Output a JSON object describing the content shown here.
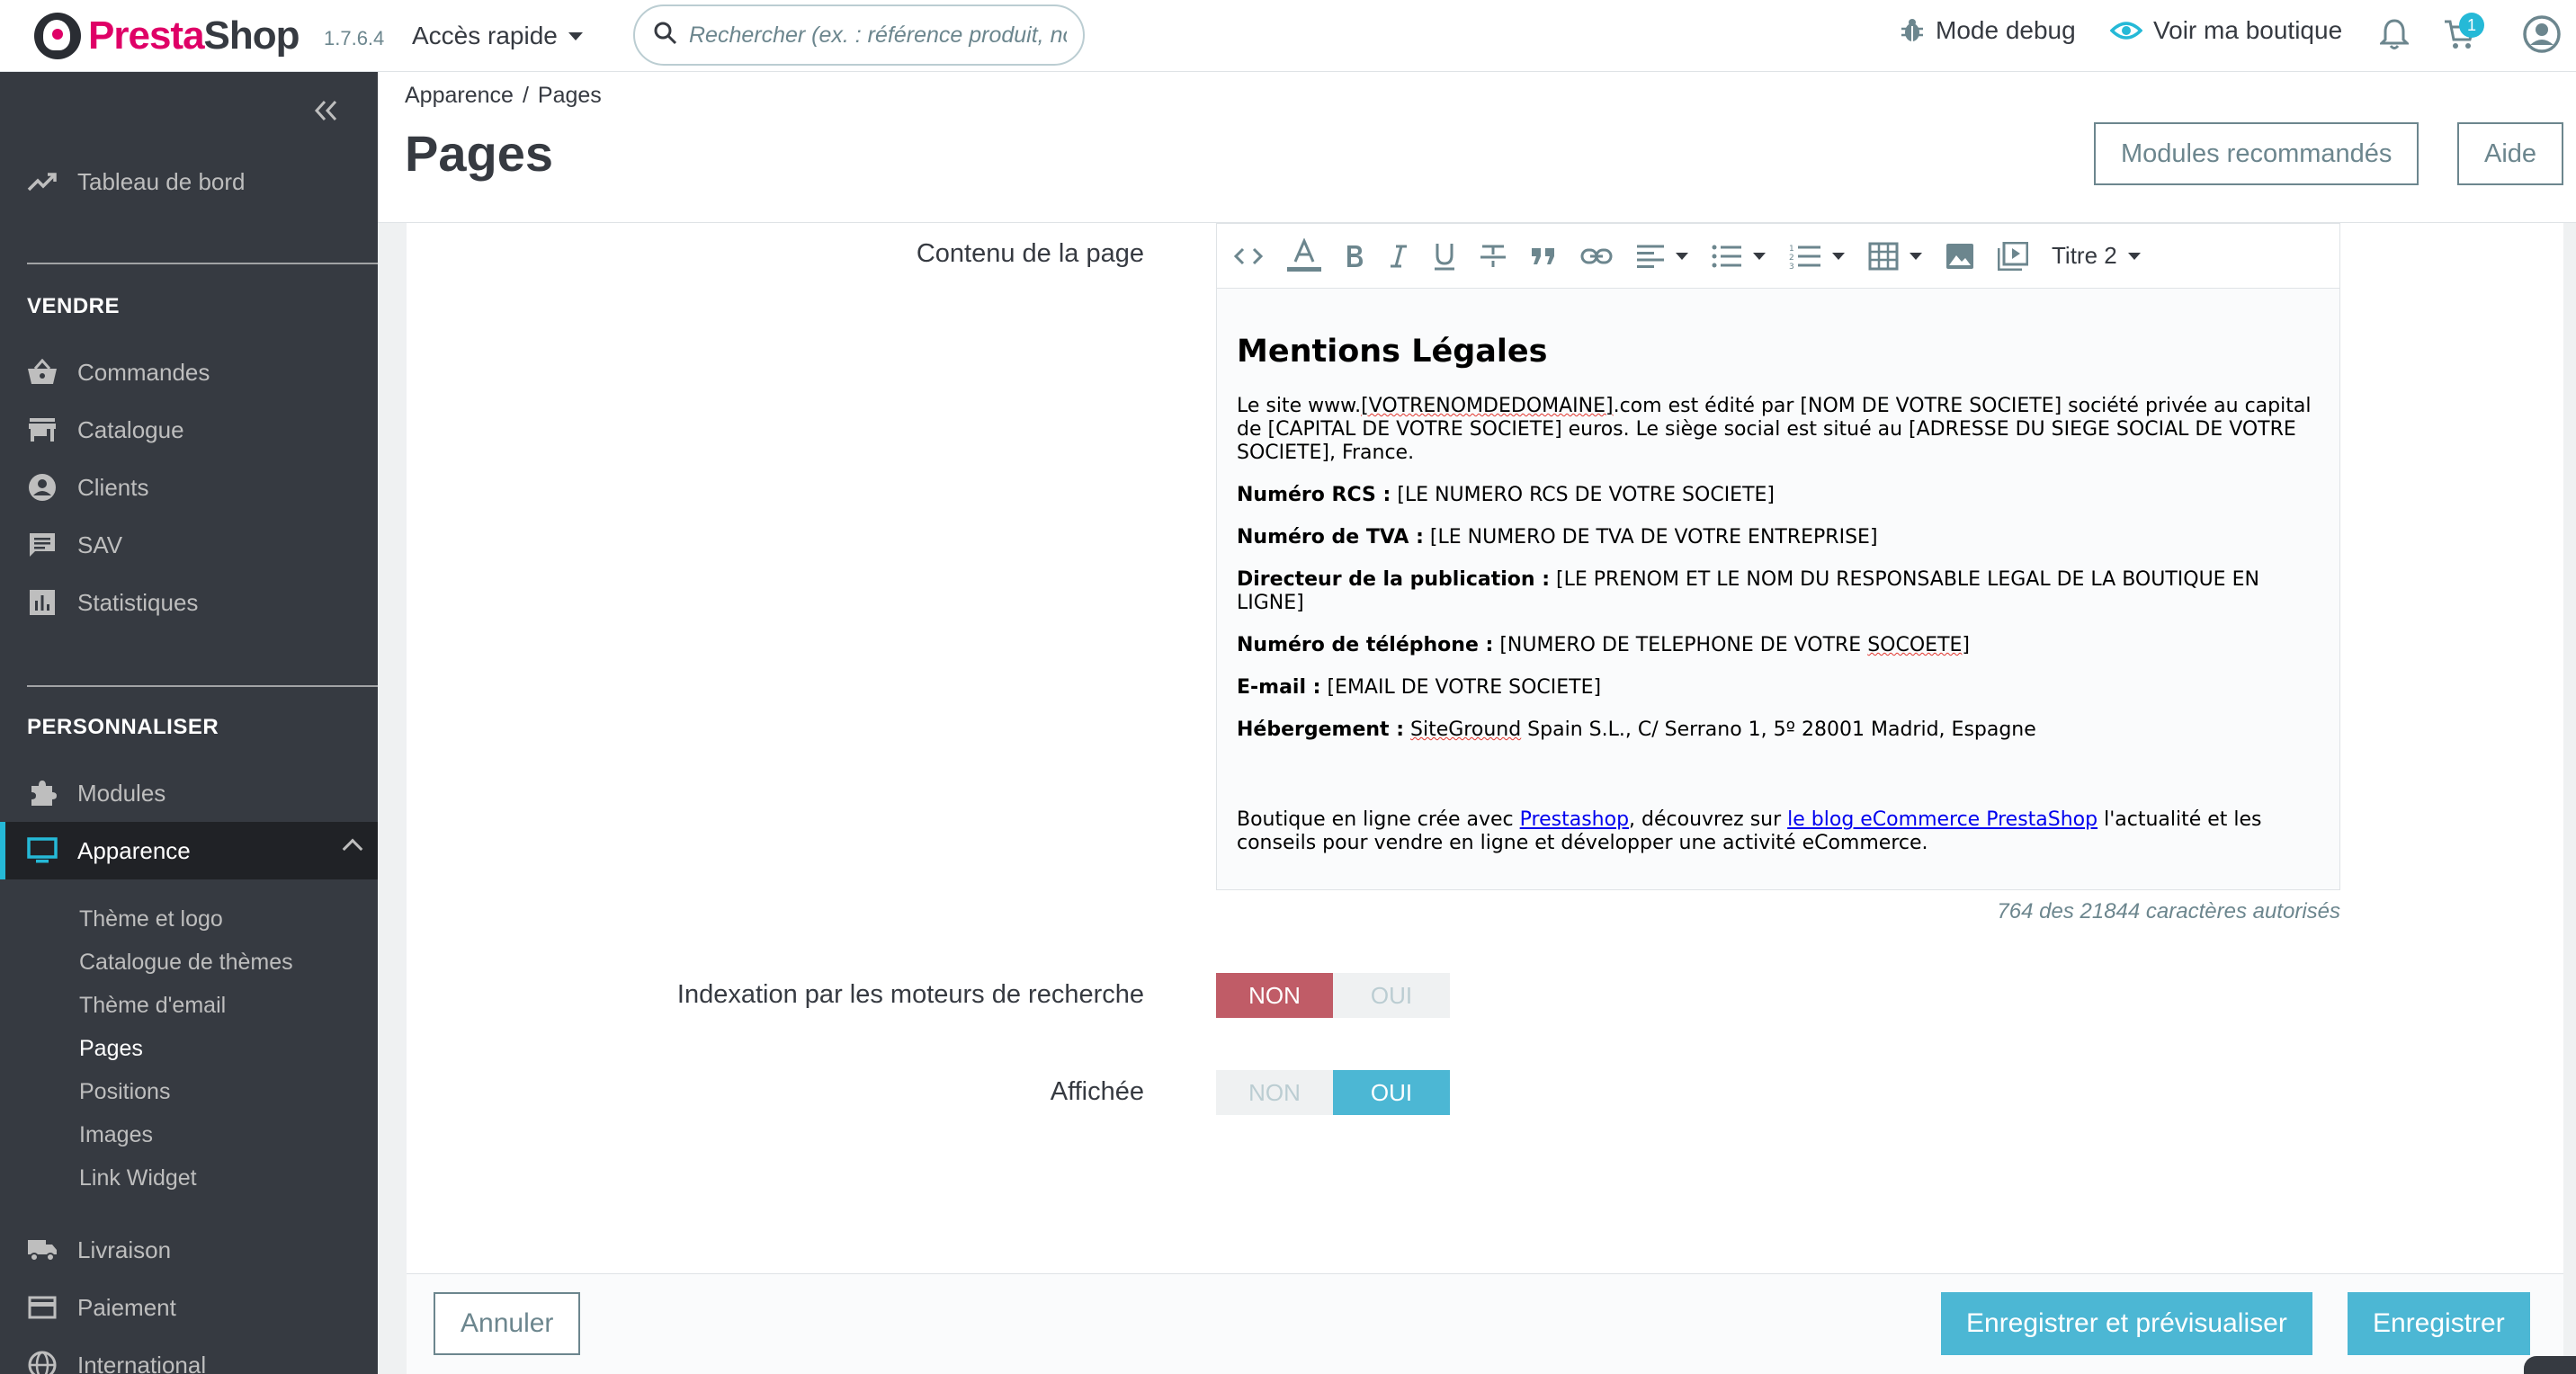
{
  "header": {
    "brand": "PrestaShop",
    "version": "1.7.6.4",
    "quick_access": "Accès rapide",
    "search_placeholder": "Rechercher (ex. : référence produit, nom",
    "debug_label": "Mode debug",
    "view_shop_label": "Voir ma boutique",
    "orders_badge": "1"
  },
  "sidebar": {
    "dashboard": "Tableau de bord",
    "section_sell": "VENDRE",
    "sell_items": [
      "Commandes",
      "Catalogue",
      "Clients",
      "SAV",
      "Statistiques"
    ],
    "section_customize": "PERSONNALISER",
    "modules": "Modules",
    "appearance": "Apparence",
    "appearance_sub": [
      "Thème et logo",
      "Catalogue de thèmes",
      "Thème d'email",
      "Pages",
      "Positions",
      "Images",
      "Link Widget"
    ],
    "shipping": "Livraison",
    "payment": "Paiement",
    "international": "International"
  },
  "pagehead": {
    "breadcrumb_parent": "Apparence",
    "breadcrumb_sep": "/",
    "breadcrumb_current": "Pages",
    "title": "Pages",
    "recommended_modules": "Modules recommandés",
    "help": "Aide"
  },
  "form": {
    "content_label": "Contenu de la page",
    "toolbar_heading": "Titre 2",
    "doc": {
      "heading": "Mentions Légales",
      "intro_a": "Le site www.",
      "intro_spell": "[VOTRENOMDEDOMAINE]",
      "intro_b": ".com est édité par [NOM DE VOTRE SOCIETE] société privée au capital de [CAPITAL DE VOTRE SOCIETE] euros. Le siège social est situé au [ADRESSE DU SIEGE SOCIAL DE VOTRE SOCIETE], France.",
      "rcs_label": "Numéro RCS :",
      "rcs_value": " [LE NUMERO RCS DE VOTRE SOCIETE]",
      "tva_label": "Numéro de TVA :",
      "tva_value": " [LE NUMERO DE TVA DE VOTRE ENTREPRISE]",
      "director_label": "Directeur de la publication :",
      "director_value": " [LE PRENOM ET LE NOM DU RESPONSABLE LEGAL DE LA BOUTIQUE EN LIGNE]",
      "phone_label": "Numéro de téléphone :",
      "phone_value_a": " [NUMERO DE TELEPHONE DE VOTRE ",
      "phone_value_spell": "SOCOETE",
      "phone_value_b": "]",
      "email_label": "E-mail :",
      "email_value": " [EMAIL DE VOTRE SOCIETE]",
      "host_label": "Hébergement :",
      "host_spell": "SiteGround",
      "host_value": " Spain S.L., C/ Serrano 1, 5º 28001 Madrid, Espagne",
      "footer_a": "Boutique en ligne crée avec ",
      "footer_link1": "Prestashop",
      "footer_b": ", découvrez sur ",
      "footer_link2": "le blog eCommerce PrestaShop",
      "footer_c": " l'actualité et les conseils pour vendre en ligne et développer une activité eCommerce."
    },
    "char_count": "764 des 21844 caractères autorisés",
    "indexation_label": "Indexation par les moteurs de recherche",
    "indexation_value": "NON",
    "displayed_label": "Affichée",
    "displayed_value": "OUI",
    "no": "NON",
    "yes": "OUI"
  },
  "footer": {
    "cancel": "Annuler",
    "save_preview": "Enregistrer et prévisualiser",
    "save": "Enregistrer"
  },
  "colors": {
    "brand": "#df0067",
    "primary": "#4cb7d4",
    "danger_switch": "#c05c67",
    "sidebar_bg": "#363a41"
  }
}
